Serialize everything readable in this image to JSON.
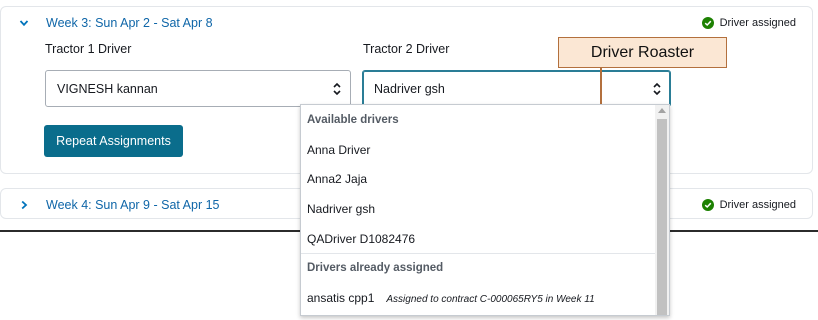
{
  "week3": {
    "title": "Week 3: Sun Apr 2 - Sat Apr 8",
    "status": "Driver assigned",
    "tractor1_label": "Tractor 1 Driver",
    "tractor2_label": "Tractor 2 Driver",
    "tractor1_value": "VIGNESH kannan",
    "tractor2_value": "Nadriver gsh",
    "repeat_button": "Repeat Assignments"
  },
  "week4": {
    "title": "Week 4: Sun Apr 9 - Sat Apr 15",
    "status": "Driver assigned"
  },
  "callout": "Driver Roaster",
  "dropdown": {
    "available_header": "Available drivers",
    "available": [
      "Anna Driver",
      "Anna2 Jaja",
      "Nadriver gsh",
      "QADriver D1082476"
    ],
    "assigned_header": "Drivers already assigned",
    "assigned": [
      {
        "name": "ansatis cpp1",
        "note": "Assigned to contract C-000065RY5 in Week 11"
      }
    ]
  },
  "colors": {
    "link": "#0f66a8",
    "primary_button": "#0a6d8c",
    "success": "#1d8102",
    "callout_fill": "#fbe7d4",
    "callout_border": "#b3703d"
  },
  "icons": {
    "expanded": "chevron-down-icon",
    "collapsed": "chevron-right-icon",
    "status": "check-circle-icon",
    "select": "up-down-arrows-icon"
  }
}
